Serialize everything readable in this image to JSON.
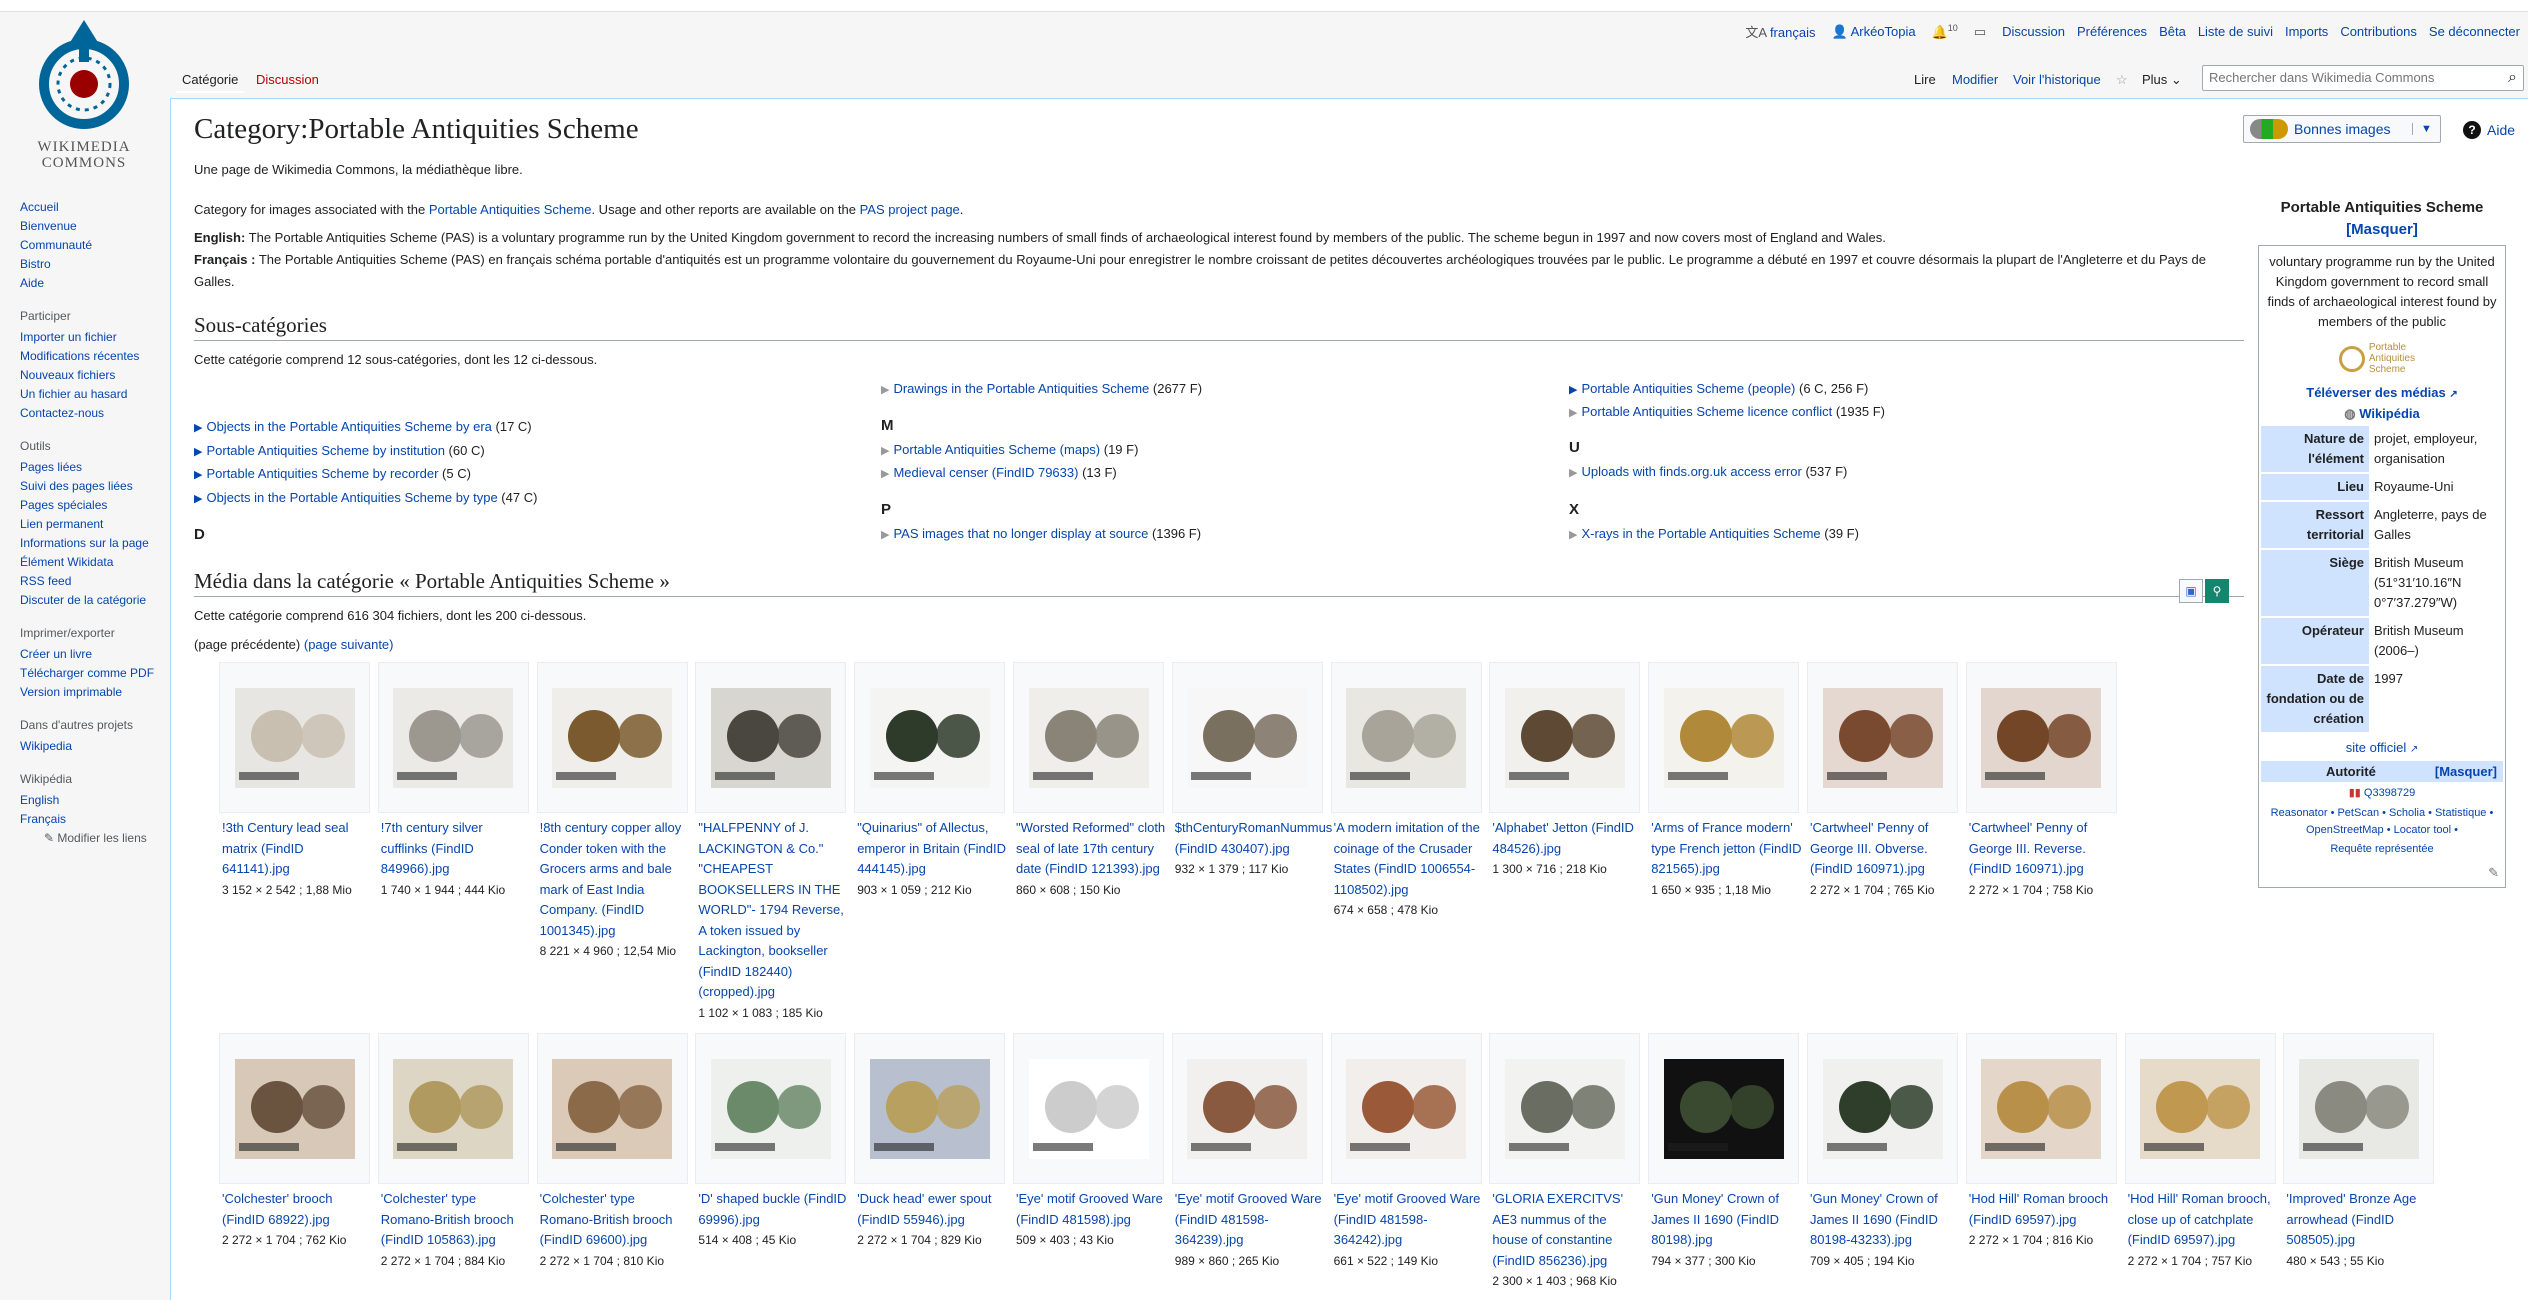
{
  "personal": {
    "lang": "français",
    "user": "ArkéoTopia",
    "notif_count": "10",
    "links": [
      "Discussion",
      "Préférences",
      "Bêta",
      "Liste de suivi",
      "Imports",
      "Contributions",
      "Se déconnecter"
    ]
  },
  "logo": {
    "line1": "WIKIMEDIA",
    "line2": "COMMONS"
  },
  "sidebar": {
    "nav": [
      "Accueil",
      "Bienvenue",
      "Communauté",
      "Bistro",
      "Aide"
    ],
    "participer_title": "Participer",
    "participer": [
      "Importer un fichier",
      "Modifications récentes",
      "Nouveaux fichiers",
      "Un fichier au hasard",
      "Contactez-nous"
    ],
    "outils_title": "Outils",
    "outils": [
      "Pages liées",
      "Suivi des pages liées",
      "Pages spéciales",
      "Lien permanent",
      "Informations sur la page",
      "Élément Wikidata",
      "RSS feed",
      "Discuter de la catégorie"
    ],
    "imprimer_title": "Imprimer/exporter",
    "imprimer": [
      "Créer un livre",
      "Télécharger comme PDF",
      "Version imprimable"
    ],
    "autres_title": "Dans d'autres projets",
    "autres": [
      "Wikipedia"
    ],
    "wikipedia_title": "Wikipédia",
    "wikipedia": [
      "English",
      "Français"
    ],
    "modify_links": "Modifier les liens"
  },
  "tabs": {
    "left": [
      "Catégorie",
      "Discussion"
    ],
    "right": [
      "Lire",
      "Modifier",
      "Voir l'historique"
    ],
    "more": "Plus",
    "search_placeholder": "Rechercher dans Wikimedia Commons"
  },
  "page": {
    "title": "Category:Portable Antiquities Scheme",
    "tagline": "Une page de Wikimedia Commons, la médiathèque libre.",
    "good_images": "Bonnes images",
    "help": "Aide",
    "intro_a": "Category for images associated with the ",
    "intro_link1": "Portable Antiquities Scheme",
    "intro_b": ". Usage and other reports are available on the ",
    "intro_link2": "PAS project page",
    "intro_c": ".",
    "en_label": "English:",
    "en_text": "The Portable Antiquities Scheme (PAS) is a voluntary programme run by the United Kingdom government to record the increasing numbers of small finds of archaeological interest found by members of the public. The scheme begun in 1997 and now covers most of England and Wales.",
    "fr_label": "Français :",
    "fr_text": "The Portable Antiquities Scheme (PAS) en français schéma portable d'antiquités est un programme volontaire du gouvernement du Royaume-Uni pour enregistrer le nombre croissant de petites découvertes archéologiques trouvées par le public. Le programme a débuté en 1997 et couvre désormais la plupart de l'Angleterre et du Pays de Galles."
  },
  "subcats": {
    "heading": "Sous-catégories",
    "count_text": "Cette catégorie comprend 12 sous-catégories, dont les 12 ci-dessous.",
    "col1": [
      {
        "name": "Objects in the Portable Antiquities Scheme by era",
        "count": "(17 C)",
        "exp": true
      },
      {
        "name": "Portable Antiquities Scheme by institution",
        "count": "(60 C)",
        "exp": true
      },
      {
        "name": "Portable Antiquities Scheme by recorder",
        "count": "(5 C)",
        "exp": true
      },
      {
        "name": "Objects in the Portable Antiquities Scheme by type",
        "count": "(47 C)",
        "exp": true
      }
    ],
    "col1_letter": "D",
    "col2_top": {
      "name": "Drawings in the Portable Antiquities Scheme",
      "count": "(2677 F)"
    },
    "col2_letter_m": "M",
    "col2_m": [
      {
        "name": "Portable Antiquities Scheme (maps)",
        "count": "(19 F)"
      },
      {
        "name": "Medieval censer (FindID 79633)",
        "count": "(13 F)"
      }
    ],
    "col2_letter_p": "P",
    "col2_p": {
      "name": "PAS images that no longer display at source",
      "count": "(1396 F)"
    },
    "col3": [
      {
        "name": "Portable Antiquities Scheme (people)",
        "count": "(6 C, 256 F)",
        "exp": true
      },
      {
        "name": "Portable Antiquities Scheme licence conflict",
        "count": "(1935 F)",
        "exp": false
      }
    ],
    "col3_letter_u": "U",
    "col3_u": {
      "name": "Uploads with finds.org.uk access error",
      "count": "(537 F)"
    },
    "col3_letter_x": "X",
    "col3_x": {
      "name": "X-rays in the Portable Antiquities Scheme",
      "count": "(39 F)"
    }
  },
  "media": {
    "heading": "Média dans la catégorie « Portable Antiquities Scheme »",
    "count_text": "Cette catégorie comprend 616 304 fichiers, dont les 200 ci-dessous.",
    "prev": "(page précédente)",
    "next": "(page suivante)",
    "row1": [
      {
        "name": "!3th Century lead seal matrix (FindID 641141).jpg",
        "meta": "3 152 × 2 542 ; 1,88 Mio",
        "bg": "#e8e6e2",
        "c": "#c9bfb0"
      },
      {
        "name": "!7th century silver cufflinks (FindID 849966).jpg",
        "meta": "1 740 × 1 944 ; 444 Kio",
        "bg": "#eceae6",
        "c": "#9c9890"
      },
      {
        "name": "!8th century copper alloy Conder token with the Grocers arms and bale mark of East India Company. (FindID 1001345).jpg",
        "meta": "8 221 × 4 960 ; 12,54 Mio",
        "bg": "#f0eeea",
        "c": "#7a5a2e"
      },
      {
        "name": "\"HALFPENNY of J. LACKINGTON & Co.\" \"CHEAPEST BOOKSELLERS IN THE WORLD\"- 1794 Reverse, A token issued by Lackington, bookseller (FindID 182440) (cropped).jpg",
        "meta": "1 102 × 1 083 ; 185 Kio",
        "bg": "#d8d6d0",
        "c": "#4a4640"
      },
      {
        "name": "\"Quinarius\" of Allectus, emperor in Britain (FindID 444145).jpg",
        "meta": "903 × 1 059 ; 212 Kio",
        "bg": "#f4f4f2",
        "c": "#2e3a2a"
      },
      {
        "name": "\"Worsted Reformed\" cloth seal of late 17th century date (FindID 121393).jpg",
        "meta": "860 × 608 ; 150 Kio",
        "bg": "#efeeea",
        "c": "#8a8478"
      },
      {
        "name": "$thCenturyRomanNummus (FindID 430407).jpg",
        "meta": "932 × 1 379 ; 117 Kio",
        "bg": "#f7f7f7",
        "c": "#7a7060"
      },
      {
        "name": "'A modern imitation of the coinage of the Crusader States (FindID 1006554-1108502).jpg",
        "meta": "674 × 658 ; 478 Kio",
        "bg": "#e9e7e2",
        "c": "#a8a49a"
      },
      {
        "name": "'Alphabet' Jetton (FindID 484526).jpg",
        "meta": "1 300 × 716 ; 218 Kio",
        "bg": "#f1f0ed",
        "c": "#5e4a34"
      },
      {
        "name": "'Arms of France modern' type French jetton (FindID 821565).jpg",
        "meta": "1 650 × 935 ; 1,18 Mio",
        "bg": "#f4f2ec",
        "c": "#b08a3a"
      },
      {
        "name": "'Cartwheel' Penny of George III. Obverse. (FindID 160971).jpg",
        "meta": "2 272 × 1 704 ; 765 Kio",
        "bg": "#e4d8d0",
        "c": "#7a4a30"
      },
      {
        "name": "'Cartwheel' Penny of George III. Reverse. (FindID 160971).jpg",
        "meta": "2 272 × 1 704 ; 758 Kio",
        "bg": "#e2d6ce",
        "c": "#744628"
      }
    ],
    "row2": [
      {
        "name": "'Colchester' brooch (FindID 68922).jpg",
        "meta": "2 272 × 1 704 ; 762 Kio",
        "bg": "#d8c8b8",
        "c": "#6a5440"
      },
      {
        "name": "'Colchester' type Romano-British brooch (FindID 105863).jpg",
        "meta": "2 272 × 1 704 ; 884 Kio",
        "bg": "#ded6c4",
        "c": "#b09a60"
      },
      {
        "name": "'Colchester' type Romano-British brooch (FindID 69600).jpg",
        "meta": "2 272 × 1 704 ; 810 Kio",
        "bg": "#dccab8",
        "c": "#8a6a48"
      },
      {
        "name": "'D' shaped buckle (FindID 69996).jpg",
        "meta": "514 × 408 ; 45 Kio",
        "bg": "#eef0ee",
        "c": "#6a8a6a"
      },
      {
        "name": "'Duck head' ewer spout (FindID 55946).jpg",
        "meta": "2 272 × 1 704 ; 829 Kio",
        "bg": "#b8c0d0",
        "c": "#b8a060"
      },
      {
        "name": "'Eye' motif Grooved Ware (FindID 481598).jpg",
        "meta": "509 × 403 ; 43 Kio",
        "bg": "#ffffff",
        "c": "#cccccc"
      },
      {
        "name": "'Eye' motif Grooved Ware (FindID 481598-364239).jpg",
        "meta": "989 × 860 ; 265 Kio",
        "bg": "#f2f0ee",
        "c": "#8a5a40"
      },
      {
        "name": "'Eye' motif Grooved Ware (FindID 481598-364242).jpg",
        "meta": "661 × 522 ; 149 Kio",
        "bg": "#f2eeec",
        "c": "#9a5a3a"
      },
      {
        "name": "'GLORIA EXERCITVS' AE3 nummus of the house of constantine (FindID 856236).jpg",
        "meta": "2 300 × 1 403 ; 968 Kio",
        "bg": "#f2f2f0",
        "c": "#6a6e62"
      },
      {
        "name": "'Gun Money' Crown of James II 1690 (FindID 80198).jpg",
        "meta": "794 × 377 ; 300 Kio",
        "bg": "#111111",
        "c": "#3a4a30"
      },
      {
        "name": "'Gun Money' Crown of James II 1690 (FindID 80198-43233).jpg",
        "meta": "709 × 405 ; 194 Kio",
        "bg": "#f0f0ee",
        "c": "#2e3e2a"
      },
      {
        "name": "'Hod Hill' Roman brooch (FindID 69597).jpg",
        "meta": "2 272 × 1 704 ; 816 Kio",
        "bg": "#e4d6c8",
        "c": "#b8904a"
      },
      {
        "name": "'Hod Hill' Roman brooch, close up of catchplate (FindID 69597).jpg",
        "meta": "2 272 × 1 704 ; 757 Kio",
        "bg": "#e6dac8",
        "c": "#c09850"
      },
      {
        "name": "'Improved' Bronze Age arrowhead (FindID 508505).jpg",
        "meta": "480 × 543 ; 55 Kio",
        "bg": "#e8e8e4",
        "c": "#8a8a80"
      }
    ]
  },
  "infobox": {
    "title": "Portable Antiquities Scheme",
    "masquer": "[Masquer]",
    "desc": "voluntary programme run by the United Kingdom government to record small finds of archaeological interest found by members of the public",
    "logo_text": "Portable Antiquities Scheme",
    "upload": "Téléverser des médias",
    "wikipedia": "Wikipédia",
    "rows": [
      {
        "k": "Nature de l'élément",
        "v": "projet, employeur, organisation"
      },
      {
        "k": "Lieu",
        "v": "Royaume-Uni"
      },
      {
        "k": "Ressort territorial",
        "v": "Angleterre, pays de Galles"
      },
      {
        "k": "Siège",
        "v": "British Museum (51°31′10.16″N 0°7′37.279″W)"
      },
      {
        "k": "Opérateur",
        "v": "British Museum (2006–)"
      },
      {
        "k": "Date de fondation ou de création",
        "v": "1997"
      }
    ],
    "official": "site officiel",
    "autorite": "Autorité",
    "autorite_mask": "[Masquer]",
    "qid": "Q3398729",
    "tools": "Reasonator • PetScan • Scholia • Statistique • OpenStreetMap • Locator tool •",
    "requete": "Requête représentée"
  }
}
